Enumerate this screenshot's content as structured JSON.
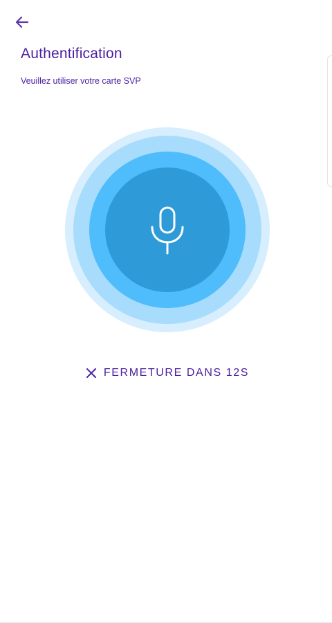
{
  "header": {
    "back_icon": "arrow-left-icon",
    "title": "Authentification",
    "subtitle": "Veuillez utiliser votre carte SVP"
  },
  "voice": {
    "icon": "microphone-icon",
    "ring_colors": [
      "#d6eefd",
      "#a8dcfd",
      "#4fbdfb",
      "#2e9ad8"
    ]
  },
  "close_timer": {
    "icon": "close-icon",
    "label": "FERMETURE DANS 12S"
  },
  "colors": {
    "accent": "#4a1fa0",
    "mic": "#ffffff"
  }
}
